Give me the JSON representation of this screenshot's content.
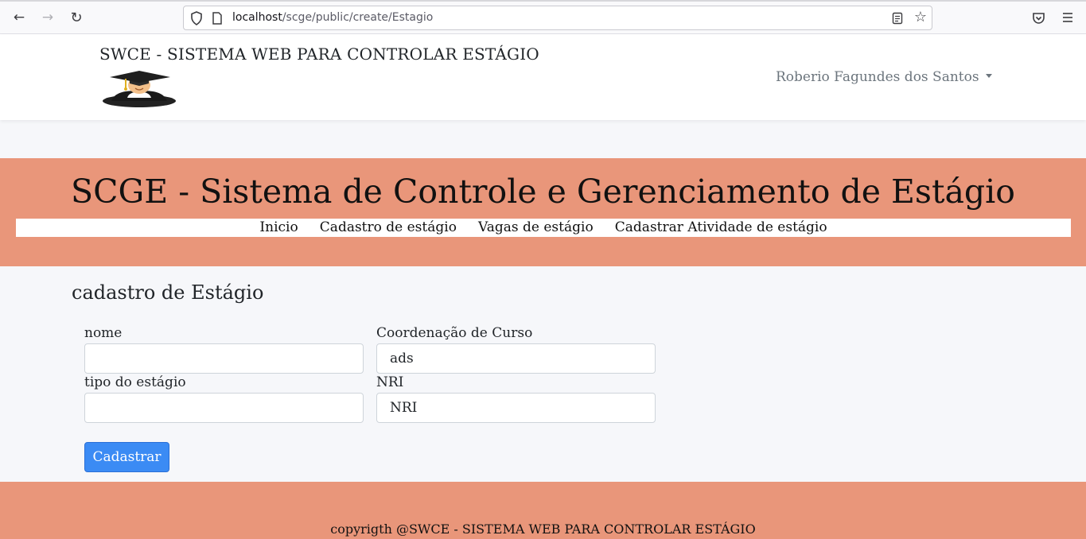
{
  "browser": {
    "url_host": "localhost",
    "url_path": "/scge/public/create/Estagio"
  },
  "header": {
    "brand_title": "SWCE - SISTEMA WEB PARA CONTROLAR ESTÁGIO",
    "user_name": "Roberio Fagundes dos Santos"
  },
  "banner": {
    "title": "SCGE - Sistema de Controle e Gerenciamento de Estágio",
    "nav": [
      {
        "label": "Inicio"
      },
      {
        "label": "Cadastro de estágio"
      },
      {
        "label": "Vagas de estágio"
      },
      {
        "label": "Cadastrar Atividade de estágio"
      }
    ]
  },
  "form": {
    "heading": "cadastro de Estágio",
    "nome": {
      "label": "nome",
      "value": ""
    },
    "coordenacao": {
      "label": "Coordenação de Curso",
      "value": "ads"
    },
    "tipo": {
      "label": "tipo do estágio",
      "value": ""
    },
    "nri": {
      "label": "NRI",
      "value": "NRI"
    },
    "submit_label": "Cadastrar"
  },
  "footer": {
    "text": "copyrigth @SWCE - SISTEMA WEB PARA CONTROLAR ESTÁGIO"
  },
  "colors": {
    "banner": "#e9967a",
    "primary_button": "#3b8bf4"
  }
}
